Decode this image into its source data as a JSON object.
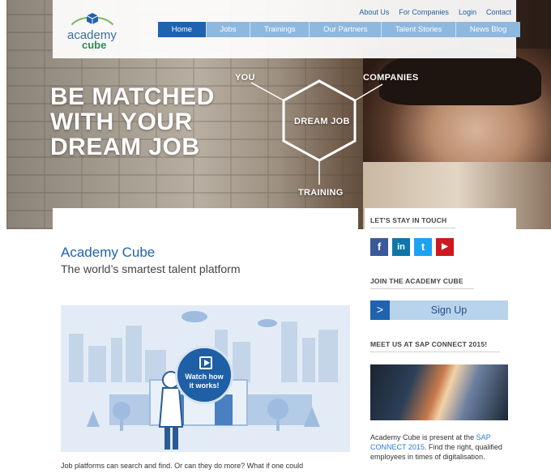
{
  "header": {
    "logo": {
      "line1": "academy",
      "line2": "cube"
    },
    "top_links": [
      "About Us",
      "For Companies",
      "Login",
      "Contact"
    ],
    "nav": [
      "Home",
      "Jobs",
      "Trainings",
      "Our Partners",
      "Talent Stories",
      "News Blog"
    ],
    "active_nav": "Home"
  },
  "hero": {
    "title": "BE MATCHED\nWITH YOUR\nDREAM JOB",
    "labels": {
      "you": "YOU",
      "companies": "COMPANIES",
      "dream_job": "DREAM JOB",
      "training": "TRAINING"
    }
  },
  "main": {
    "title": "Academy Cube",
    "subtitle": "The world’s smartest talent platform",
    "video_button": "Watch how\nit works!",
    "body": "Job platforms can search and find. Or can they do more? What if one could"
  },
  "sidebar": {
    "stay_in_touch": "LET'S STAY IN TOUCH",
    "social": [
      {
        "name": "facebook-icon",
        "glyph": "f",
        "color": "#3b5998"
      },
      {
        "name": "linkedin-icon",
        "glyph": "in",
        "color": "#0e76a8"
      },
      {
        "name": "twitter-icon",
        "glyph": "t",
        "color": "#1da1f2"
      },
      {
        "name": "youtube-icon",
        "glyph": "▶",
        "color": "#cc181e"
      }
    ],
    "join_heading": "JOIN THE ACADEMY CUBE",
    "signup_arrow": ">",
    "signup_label": "Sign Up",
    "meet_heading": "MEET US AT SAP CONNECT 2015!",
    "sap_text_pre": "Academy Cube is present at the ",
    "sap_link": "SAP CONNECT 2015",
    "sap_text_post": ". Find the right, qualified employees in times of digitalisation."
  },
  "colors": {
    "brand_blue": "#1f63b0",
    "nav_light": "#8fb8de",
    "signup_bg": "#b8d3ec",
    "logo_green": "#2e8b57"
  }
}
